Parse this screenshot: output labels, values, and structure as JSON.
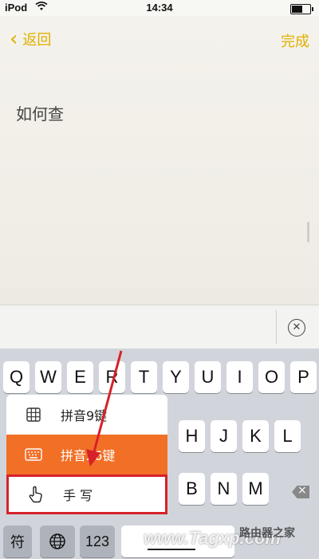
{
  "status": {
    "carrier": "iPod",
    "time": "14:34",
    "battery_level": 0.6
  },
  "nav": {
    "back_label": "返回",
    "done_label": "完成"
  },
  "note": {
    "text": "如何查"
  },
  "keyboard": {
    "row1": [
      "Q",
      "W",
      "E",
      "R",
      "T",
      "Y",
      "U",
      "I",
      "O",
      "P"
    ],
    "row2": [
      "H",
      "J",
      "K",
      "L"
    ],
    "row3": [
      "B",
      "N",
      "M"
    ],
    "bottom": {
      "symbols": "符",
      "numbers": "123"
    }
  },
  "input_methods": [
    {
      "label": "拼音9键",
      "icon": "grid-keypad-icon"
    },
    {
      "label": "拼音26键",
      "icon": "keyboard-icon",
      "selected": true
    },
    {
      "label": "手 写",
      "icon": "hand-pointer-icon",
      "highlighted": true
    }
  ],
  "watermark": {
    "text": "www.Tagxp.com",
    "site": "路由器之家"
  },
  "colors": {
    "accent": "#e0b000",
    "selected": "#f26f26",
    "highlight": "#d7212a"
  }
}
